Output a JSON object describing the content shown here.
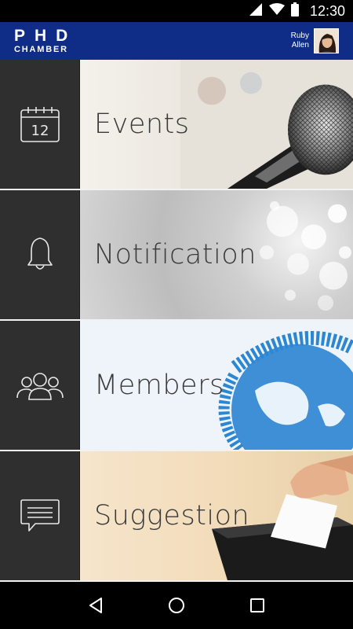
{
  "status_bar": {
    "time": "12:30",
    "icons": [
      "wifi-icon",
      "signal-icon",
      "battery-icon"
    ]
  },
  "header": {
    "logo_main": "PHD",
    "logo_sub": "CHAMBER",
    "user_first": "Ruby",
    "user_last": "Allen"
  },
  "menu": {
    "items": [
      {
        "label": "Events",
        "icon": "calendar-icon",
        "calendar_day": "12"
      },
      {
        "label": "Notification",
        "icon": "bell-icon"
      },
      {
        "label": "Members",
        "icon": "group-icon"
      },
      {
        "label": "Suggestion",
        "icon": "message-icon"
      }
    ]
  },
  "nav_bar": {
    "buttons": [
      "back-icon",
      "home-icon",
      "recents-icon"
    ]
  },
  "colors": {
    "header_bg": "#0f2c86",
    "tile_icon_bg": "#2f2f2f",
    "status_bar_bg": "#000000"
  }
}
